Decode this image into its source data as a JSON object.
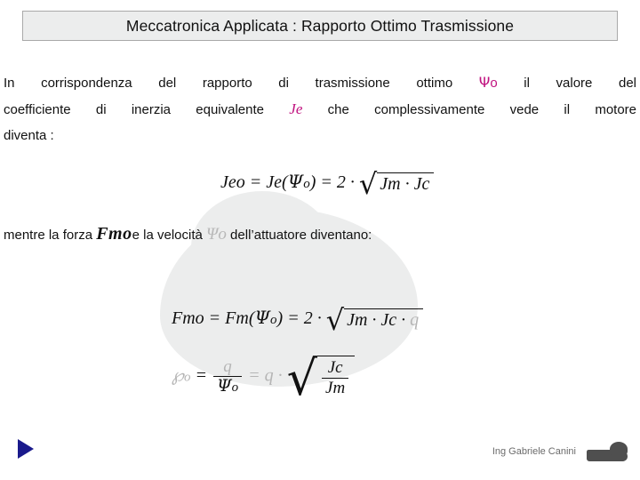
{
  "slide": {
    "title": "Meccatronica Applicata :  Rapporto Ottimo Trasmissione",
    "paragraph": {
      "line1_a": "In  corrispondenza  del  rapporto  di  trasmissione  ottimo",
      "line1_psi": "Ψ",
      "line1_psi_sub": "o",
      "line1_b": "il  valore  del",
      "line2_a": "coefficiente  di  inerzia  equivalente",
      "line2_je": "Je",
      "line2_b": "che  complessivamente  vede  il  motore",
      "line3": "diventa :"
    },
    "formula1": {
      "lhs": "Jeo = Je(",
      "psi": "Ψ",
      "psi_sub": "o",
      "mid": ") = 2 ·",
      "radicand": "Jm · Jc"
    },
    "midline": {
      "a": "mentre la forza",
      "fmo": "Fmo",
      "b": "e la velocità",
      "psio": "Ψo",
      "c": "dell’attuatore diventano:"
    },
    "formula2": {
      "lhs": "Fmo = Fm(",
      "psi": "Ψ",
      "psi_sub": "o",
      "mid": ") = 2 ·",
      "radicand": "Jm · Jc ·",
      "trailing": "q"
    },
    "formula3": {
      "lhs_sym": "℘",
      "lhs_sub": "o",
      "eq": "=",
      "frac_num": "q",
      "frac_den": "Ψ",
      "frac_den_sub": "o",
      "mid": "= q ·",
      "rad_num": "Jc",
      "rad_den": "Jm"
    },
    "footer": {
      "credit": "Ing Gabriele Canini"
    },
    "icons": {
      "nav_arrow": "play-triangle-icon",
      "logo": "duck-logo-icon"
    },
    "colors": {
      "title_bg": "#eceded",
      "title_border": "#a9a9a9",
      "accent_magenta": "#c0127f",
      "nav_arrow": "#1a1a8c",
      "text": "#111111",
      "footer_text": "#6b6b6b"
    }
  }
}
